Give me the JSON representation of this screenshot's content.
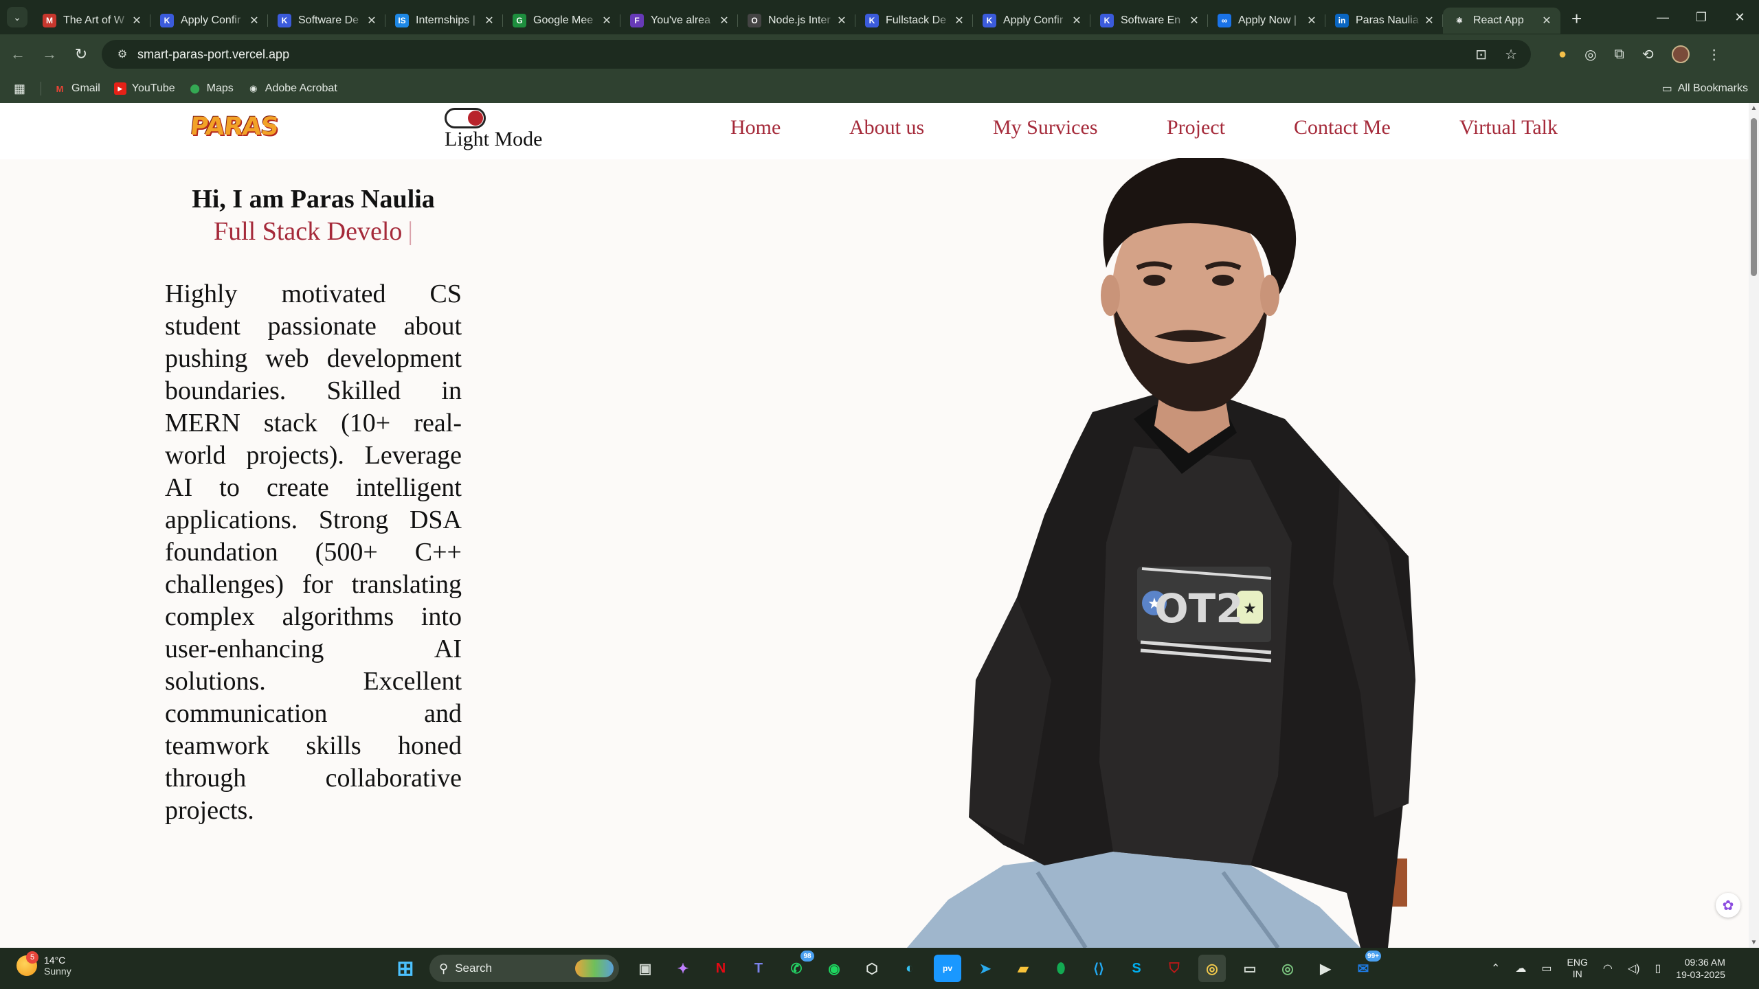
{
  "browser": {
    "tabs": [
      {
        "title": "The Art of W",
        "fav": "M",
        "color": "#c7372d"
      },
      {
        "title": "Apply Confir",
        "fav": "K",
        "color": "#3b5bdb"
      },
      {
        "title": "Software De",
        "fav": "K",
        "color": "#3b5bdb"
      },
      {
        "title": "Internships |",
        "fav": "IS",
        "color": "#1e88e5"
      },
      {
        "title": "Google Mee",
        "fav": "G",
        "color": "#1e8e3e"
      },
      {
        "title": "You've alrea",
        "fav": "F",
        "color": "#673ab7"
      },
      {
        "title": "Node.js Inter",
        "fav": "O",
        "color": "#444444"
      },
      {
        "title": "Fullstack De",
        "fav": "K",
        "color": "#3b5bdb"
      },
      {
        "title": "Apply Confir",
        "fav": "K",
        "color": "#3b5bdb"
      },
      {
        "title": "Software En",
        "fav": "K",
        "color": "#3b5bdb"
      },
      {
        "title": "Apply Now |",
        "fav": "∞",
        "color": "#1a73e8"
      },
      {
        "title": "Paras Naulia",
        "fav": "in",
        "color": "#0a66c2"
      },
      {
        "title": "React App",
        "fav": "⚛",
        "color": "#2f4130",
        "active": true
      }
    ],
    "url": "smart-paras-port.vercel.app",
    "bookmarks": [
      {
        "label": "Gmail",
        "icon": "gmail-icon"
      },
      {
        "label": "YouTube",
        "icon": "youtube-icon"
      },
      {
        "label": "Maps",
        "icon": "maps-icon"
      },
      {
        "label": "Adobe Acrobat",
        "icon": "acrobat-icon"
      }
    ],
    "all_bookmarks": "All Bookmarks"
  },
  "site": {
    "logo": "PARAS",
    "mode_label": "Light Mode",
    "menu": [
      "Home",
      "About us",
      "My Survices",
      "Project",
      "Contact Me",
      "Virtual Talk"
    ],
    "greeting": "Hi, I am Paras Naulia",
    "role": "Full Stack Develo",
    "role_cursor": "|",
    "bio": "Highly motivated CS student passionate about pushing web development boundaries. Skilled in MERN stack (10+ real-world projects). Leverage AI to create intelligent applications. Strong DSA foundation (500+ C++ challenges) for translating complex algorithms into user-enhancing AI solutions. Excellent communication and teamwork skills honed through collaborative projects.",
    "shirt_text": "OT2"
  },
  "taskbar": {
    "weather_temp": "14°C",
    "weather_desc": "Sunny",
    "weather_badge": "5",
    "search": "Search",
    "whatsapp_count": "98",
    "outlook_count": "99+",
    "lang_line1": "ENG",
    "lang_line2": "IN",
    "time": "09:36 AM",
    "date": "19-03-2025"
  }
}
